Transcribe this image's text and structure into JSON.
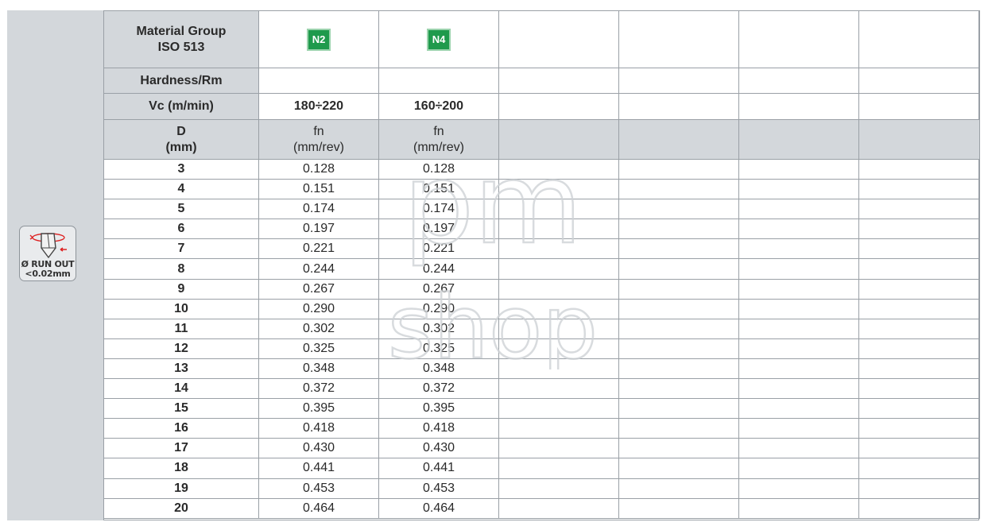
{
  "header": {
    "material_group": [
      "Material Group",
      "ISO 513"
    ],
    "hardness": "Hardness/Rm",
    "vc": "Vc (m/min)",
    "d_label": [
      "D",
      "(mm)"
    ],
    "fn_label": [
      "fn",
      "(mm/rev)"
    ]
  },
  "groups": [
    {
      "badge": "N2",
      "vc": "180÷220",
      "color": "#1f9a4c"
    },
    {
      "badge": "N4",
      "vc": "160÷200",
      "color": "#1f9a4c"
    }
  ],
  "runout_icon": {
    "line1": "Ø RUN OUT",
    "line2": "<0.02mm",
    "icon": "drill-runout-icon"
  },
  "watermark": {
    "top": "pm",
    "bottom": "shop"
  },
  "rows": [
    {
      "d": "3",
      "n2": "0.128",
      "n4": "0.128"
    },
    {
      "d": "4",
      "n2": "0.151",
      "n4": "0.151"
    },
    {
      "d": "5",
      "n2": "0.174",
      "n4": "0.174"
    },
    {
      "d": "6",
      "n2": "0.197",
      "n4": "0.197"
    },
    {
      "d": "7",
      "n2": "0.221",
      "n4": "0.221"
    },
    {
      "d": "8",
      "n2": "0.244",
      "n4": "0.244"
    },
    {
      "d": "9",
      "n2": "0.267",
      "n4": "0.267"
    },
    {
      "d": "10",
      "n2": "0.290",
      "n4": "0.290"
    },
    {
      "d": "11",
      "n2": "0.302",
      "n4": "0.302"
    },
    {
      "d": "12",
      "n2": "0.325",
      "n4": "0.325"
    },
    {
      "d": "13",
      "n2": "0.348",
      "n4": "0.348"
    },
    {
      "d": "14",
      "n2": "0.372",
      "n4": "0.372"
    },
    {
      "d": "15",
      "n2": "0.395",
      "n4": "0.395"
    },
    {
      "d": "16",
      "n2": "0.418",
      "n4": "0.418"
    },
    {
      "d": "17",
      "n2": "0.430",
      "n4": "0.430"
    },
    {
      "d": "18",
      "n2": "0.441",
      "n4": "0.441"
    },
    {
      "d": "19",
      "n2": "0.453",
      "n4": "0.453"
    },
    {
      "d": "20",
      "n2": "0.464",
      "n4": "0.464"
    }
  ]
}
